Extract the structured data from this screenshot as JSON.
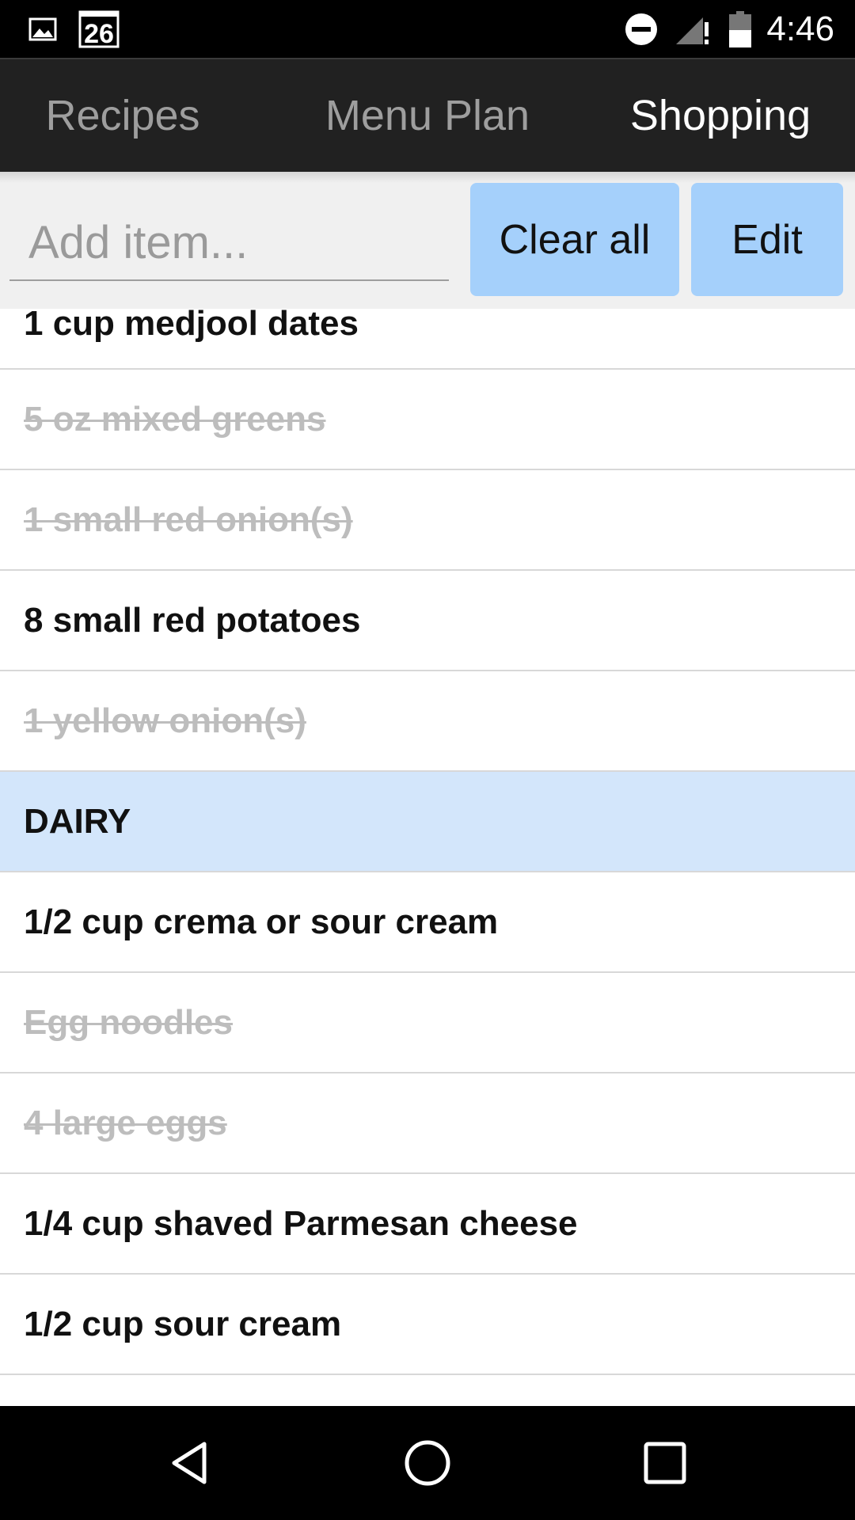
{
  "status_bar": {
    "calendar_day": "26",
    "time": "4:46",
    "icons": [
      "image-icon",
      "calendar-icon",
      "do-not-disturb-icon",
      "signal-icon",
      "battery-icon"
    ]
  },
  "tabs": [
    {
      "label": "Recipes",
      "active": false
    },
    {
      "label": "Menu Plan",
      "active": false
    },
    {
      "label": "Shopping",
      "active": true
    }
  ],
  "toolbar": {
    "add_placeholder": "Add item...",
    "add_value": "",
    "clear_all_label": "Clear all",
    "edit_label": "Edit"
  },
  "list": {
    "items": [
      {
        "text": "1 cup medjool dates",
        "checked": false
      },
      {
        "text": "5 oz mixed greens",
        "checked": true
      },
      {
        "text": "1 small red onion(s)",
        "checked": true
      },
      {
        "text": "8 small red potatoes",
        "checked": false
      },
      {
        "text": "1 yellow onion(s)",
        "checked": true
      },
      {
        "text": "DAIRY",
        "category": true
      },
      {
        "text": "1/2 cup crema or sour cream",
        "checked": false
      },
      {
        "text": "Egg noodles",
        "checked": true
      },
      {
        "text": "4 large eggs",
        "checked": true
      },
      {
        "text": "1/4 cup shaved Parmesan cheese",
        "checked": false
      },
      {
        "text": "1/2 cup sour cream",
        "checked": false
      }
    ]
  },
  "nav_bar": {
    "icons": [
      "back-icon",
      "home-icon",
      "recents-icon"
    ]
  },
  "colors": {
    "button_bg": "#a5d0fb",
    "category_bg": "#d3e6fb",
    "tab_bar_bg": "#212121",
    "checked_text": "#bdbdbd"
  }
}
